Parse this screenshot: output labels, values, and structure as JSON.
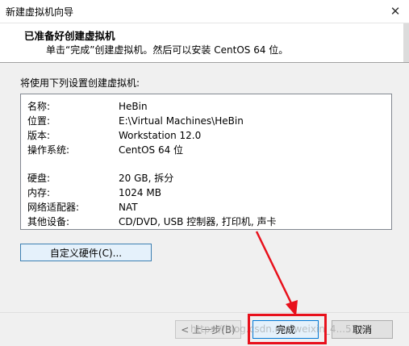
{
  "window": {
    "title": "新建虚拟机向导",
    "close_glyph": "✕"
  },
  "header": {
    "title": "已准备好创建虚拟机",
    "subtitle": "单击“完成”创建虚拟机。然后可以安装 CentOS 64 位。"
  },
  "intro_text": "将使用下列设置创建虚拟机:",
  "summary": {
    "rows": [
      {
        "label": "名称:",
        "value": "HeBin"
      },
      {
        "label": "位置:",
        "value": "E:\\Virtual Machines\\HeBin"
      },
      {
        "label": "版本:",
        "value": "Workstation 12.0"
      },
      {
        "label": "操作系统:",
        "value": "CentOS 64 位"
      },
      {
        "label": "硬盘:",
        "value": "20 GB, 拆分"
      },
      {
        "label": "内存:",
        "value": "1024 MB"
      },
      {
        "label": "网络适配器:",
        "value": "NAT"
      },
      {
        "label": "其他设备:",
        "value": "CD/DVD, USB 控制器, 打印机, 声卡"
      }
    ]
  },
  "buttons": {
    "customize": "自定义硬件(C)...",
    "back": "< 上一步(B)",
    "finish": "完成",
    "cancel": "取消"
  },
  "watermark": "https://blog.csdn.net/weixin_4...5194",
  "annotation": {
    "color": "#e8101b"
  }
}
